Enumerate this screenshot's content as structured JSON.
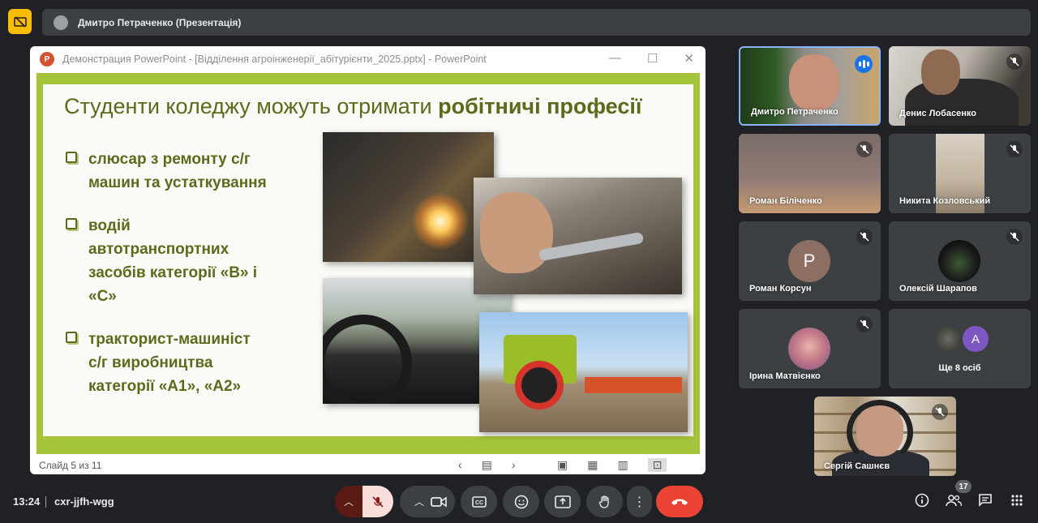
{
  "meeting": {
    "presenter_banner": "Дмитро Петраченко (Презентація)",
    "time": "13:24",
    "meeting_code": "cxr-jjfh-wgg",
    "participant_count": "17"
  },
  "ppt": {
    "window_title": "Демонстрация PowerPoint - [Відділення агроінженерії_абітурієнти_2025.pptx] - PowerPoint",
    "logo_letter": "P",
    "minimize": "—",
    "maximize": "☐",
    "close": "✕",
    "slide_status": "Слайд 5 из 11"
  },
  "slide": {
    "title_regular": "Студенти коледжу можуть отримати ",
    "title_bold": "робітничі професії",
    "bullets": [
      {
        "line1": "слюсар з ремонту с/г",
        "line2": "машин та устаткування",
        "line3": "",
        "line4": ""
      },
      {
        "line1": "водій",
        "line2": "автотранспортних",
        "line3": "засобів категорії «В» і",
        "line4": "«С»"
      },
      {
        "line1": "тракторист-машиніст",
        "line2": "с/г виробництва",
        "line3": "категорії «А1», «А2»",
        "line4": ""
      }
    ]
  },
  "participants": [
    {
      "name": "Дмитро Петраченко",
      "speaking": true
    },
    {
      "name": "Денис Лобасенко",
      "muted": true
    },
    {
      "name": "Роман Біліченко",
      "muted": true
    },
    {
      "name": "Никита Козловський",
      "muted": true
    },
    {
      "name": "Роман Корсун",
      "muted": true,
      "initial": "P",
      "color": "#8d6e63"
    },
    {
      "name": "Олексій Шарапов",
      "muted": true
    },
    {
      "name": "Ірина Матвієнко",
      "muted": true
    },
    {
      "more_initial": "A",
      "more_label": "Ще 8 осіб"
    }
  ],
  "self_view": {
    "name": "Сергій Сашнєв"
  },
  "colors": {
    "end_call": "#ea4335",
    "accent": "#1a73e8",
    "present_badge": "#fbbc04",
    "slide_green": "#a5c43a"
  }
}
